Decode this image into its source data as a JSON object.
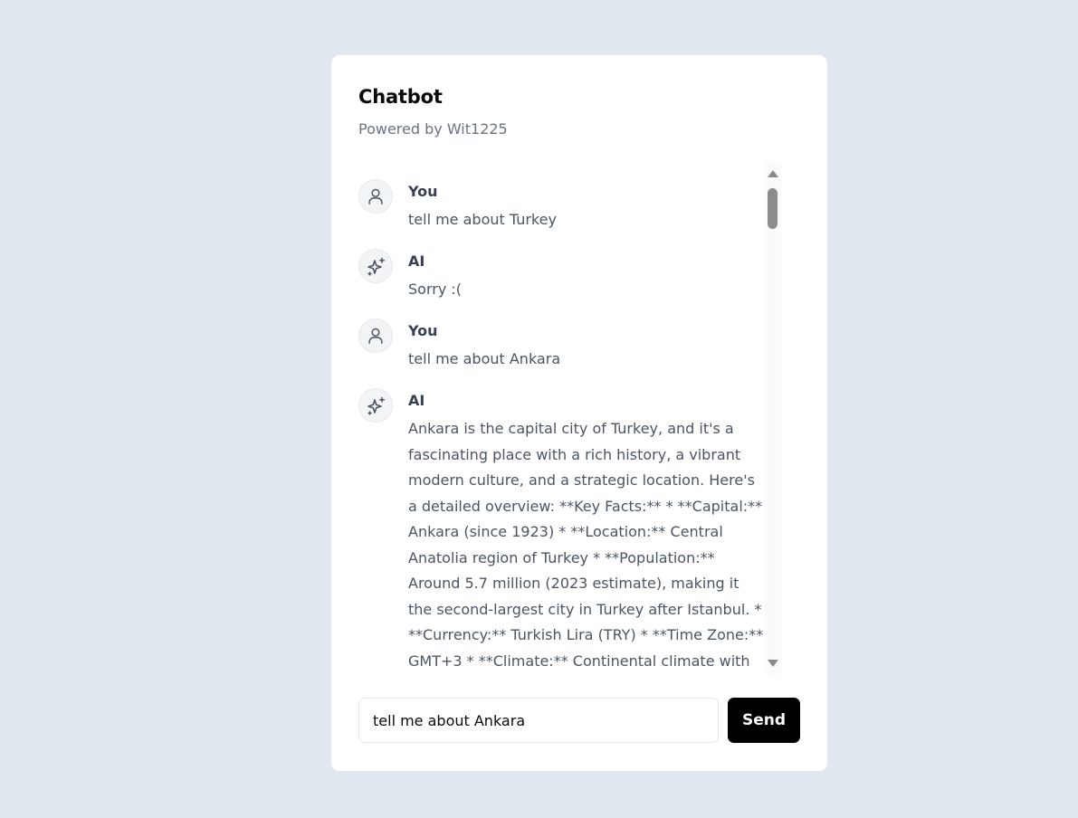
{
  "header": {
    "title": "Chatbot",
    "subtitle": "Powered by Wit1225"
  },
  "messages": [
    {
      "sender": "You",
      "icon": "user-icon",
      "text": "tell me about Turkey"
    },
    {
      "sender": "AI",
      "icon": "sparkles-icon",
      "text": "Sorry :("
    },
    {
      "sender": "You",
      "icon": "user-icon",
      "text": "tell me about Ankara"
    },
    {
      "sender": "AI",
      "icon": "sparkles-icon",
      "text": "Ankara is the capital city of Turkey, and it's a fascinating place with a rich history, a vibrant modern culture, and a strategic location. Here's a detailed overview: **Key Facts:** * **Capital:** Ankara (since 1923) * **Location:** Central Anatolia region of Turkey * **Population:** Around 5.7 million (2023 estimate), making it the second-largest city in Turkey after Istanbul. * **Currency:** Turkish Lira (TRY) * **Time Zone:** GMT+3 * **Climate:** Continental climate with hot, dry"
    }
  ],
  "composer": {
    "input_value": "tell me about Ankara",
    "send_label": "Send"
  }
}
